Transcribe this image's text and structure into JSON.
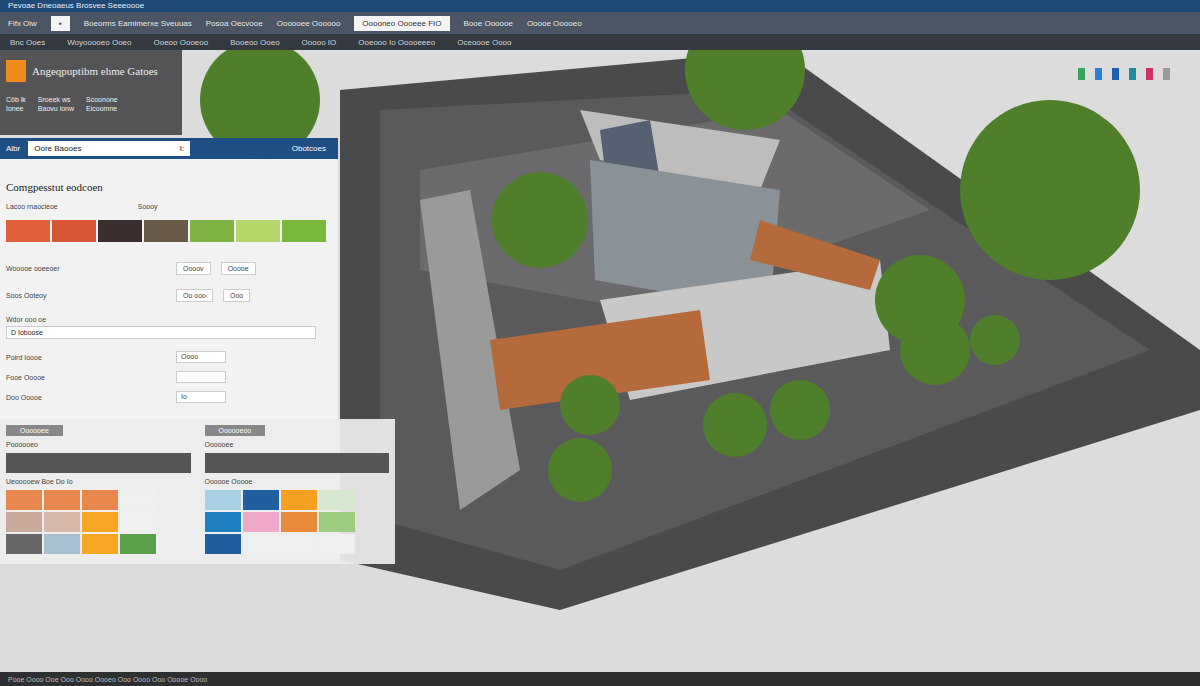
{
  "window": {
    "title": "Pevoae Dneoaeus  Brosvee Seeeoooe"
  },
  "toolbar": {
    "items": [
      {
        "label": "Fifx Oiw",
        "kind": "label"
      },
      {
        "label": "▪",
        "kind": "field"
      },
      {
        "label": "Boeorms Eamimerxe Sveuuas",
        "kind": "label"
      },
      {
        "label": "Posoa Oecvooe",
        "kind": "label"
      },
      {
        "label": "Oooooee Oooooo",
        "kind": "label"
      },
      {
        "label": "Ooooneo Oooeee  FIO",
        "kind": "field"
      },
      {
        "label": "Booe Oooooe",
        "kind": "label"
      },
      {
        "label": "Ooooe Ooooeo",
        "kind": "label"
      }
    ]
  },
  "toolbar2": {
    "items": [
      "Bnc Ooes",
      "Woyooooeo Ooeo",
      "Ooeoo Oooeoo",
      "Booeoo Ooeo",
      "Ooooo  IO",
      "Ooeooo  Io Ooooeeeo",
      "Oceoooe Oooo"
    ]
  },
  "view_icons": [
    {
      "color": "#3aa35a"
    },
    {
      "color": "#2a7fd0"
    },
    {
      "color": "#1f5fb0"
    },
    {
      "color": "#1f8fa0"
    },
    {
      "color": "#d0306a"
    },
    {
      "color": "#9a9a9a"
    }
  ],
  "app_card": {
    "title": "Angeqpuptibm ehme Gatoes",
    "stats": [
      {
        "label": "Cöb lk",
        "value": "Ionee"
      },
      {
        "label": "Sroeek ws",
        "value": "Baovu ionw"
      },
      {
        "label": "Scoonone",
        "value": "Eicoomne"
      }
    ]
  },
  "panel": {
    "tab": "Aibr",
    "search": "Oore Baooes",
    "search_icon": "I:",
    "right_label": "Obotcoes",
    "heading": "Comgpesstut eodcoen",
    "palette_labels": [
      "Lacoo rnaocieoe",
      "Soooy"
    ],
    "palette": [
      {
        "color": "#e0603a"
      },
      {
        "color": "#d65535"
      },
      {
        "color": "#3a2f2e"
      },
      {
        "color": "#6a5a48"
      },
      {
        "color": "#7cb342"
      },
      {
        "color": "#b5d66a"
      },
      {
        "color": "#79b83c"
      }
    ],
    "rows": [
      {
        "label": "Wooooe ooeeoer",
        "a": "Oooov",
        "b": "Ooooe"
      },
      {
        "label": "Soos Ooteoy",
        "a": "Oo  ooo",
        "b": "Ooo"
      }
    ],
    "field_label": "Wdor ooo oe",
    "field_value": "D Ioboose",
    "small_rows": [
      {
        "label": "Poird Ioooe",
        "value": "Oooo"
      },
      {
        "label": "Fooe Ooooe",
        "value": ""
      },
      {
        "label": "Doo Ooooe",
        "value": "Io"
      }
    ]
  },
  "swatch_groups": [
    {
      "tab": "Oooooee",
      "title": "Poooooeo",
      "subtitle": "Ueooooew Boe Do Io",
      "colors": [
        "#e8874e",
        "#e8874e",
        "#e8874e",
        "#efefef",
        "#c8a898",
        "#d8b8a8",
        "#f5a623",
        "#efefef",
        "#666666",
        "#a9c0d0",
        "#f5a623",
        "#5aa04a"
      ]
    },
    {
      "tab": "Oooooeoo",
      "title": "Oooooee",
      "subtitle": "Oooooe     Ooooe",
      "colors": [
        "#a8d0e6",
        "#1f5fa0",
        "#f5a020",
        "#d8e8d0",
        "#1f80c0",
        "#f0a8c8",
        "#e88a3a",
        "#9ccc80",
        "#1f5fa0",
        "#efefef",
        "#efefef",
        "#efefef"
      ]
    }
  ],
  "status_bar": {
    "text": "Pooe Oooo Ooe Ooo Oooo Oooeo Ooo Oooo Ooo Ooooe Oooo"
  }
}
